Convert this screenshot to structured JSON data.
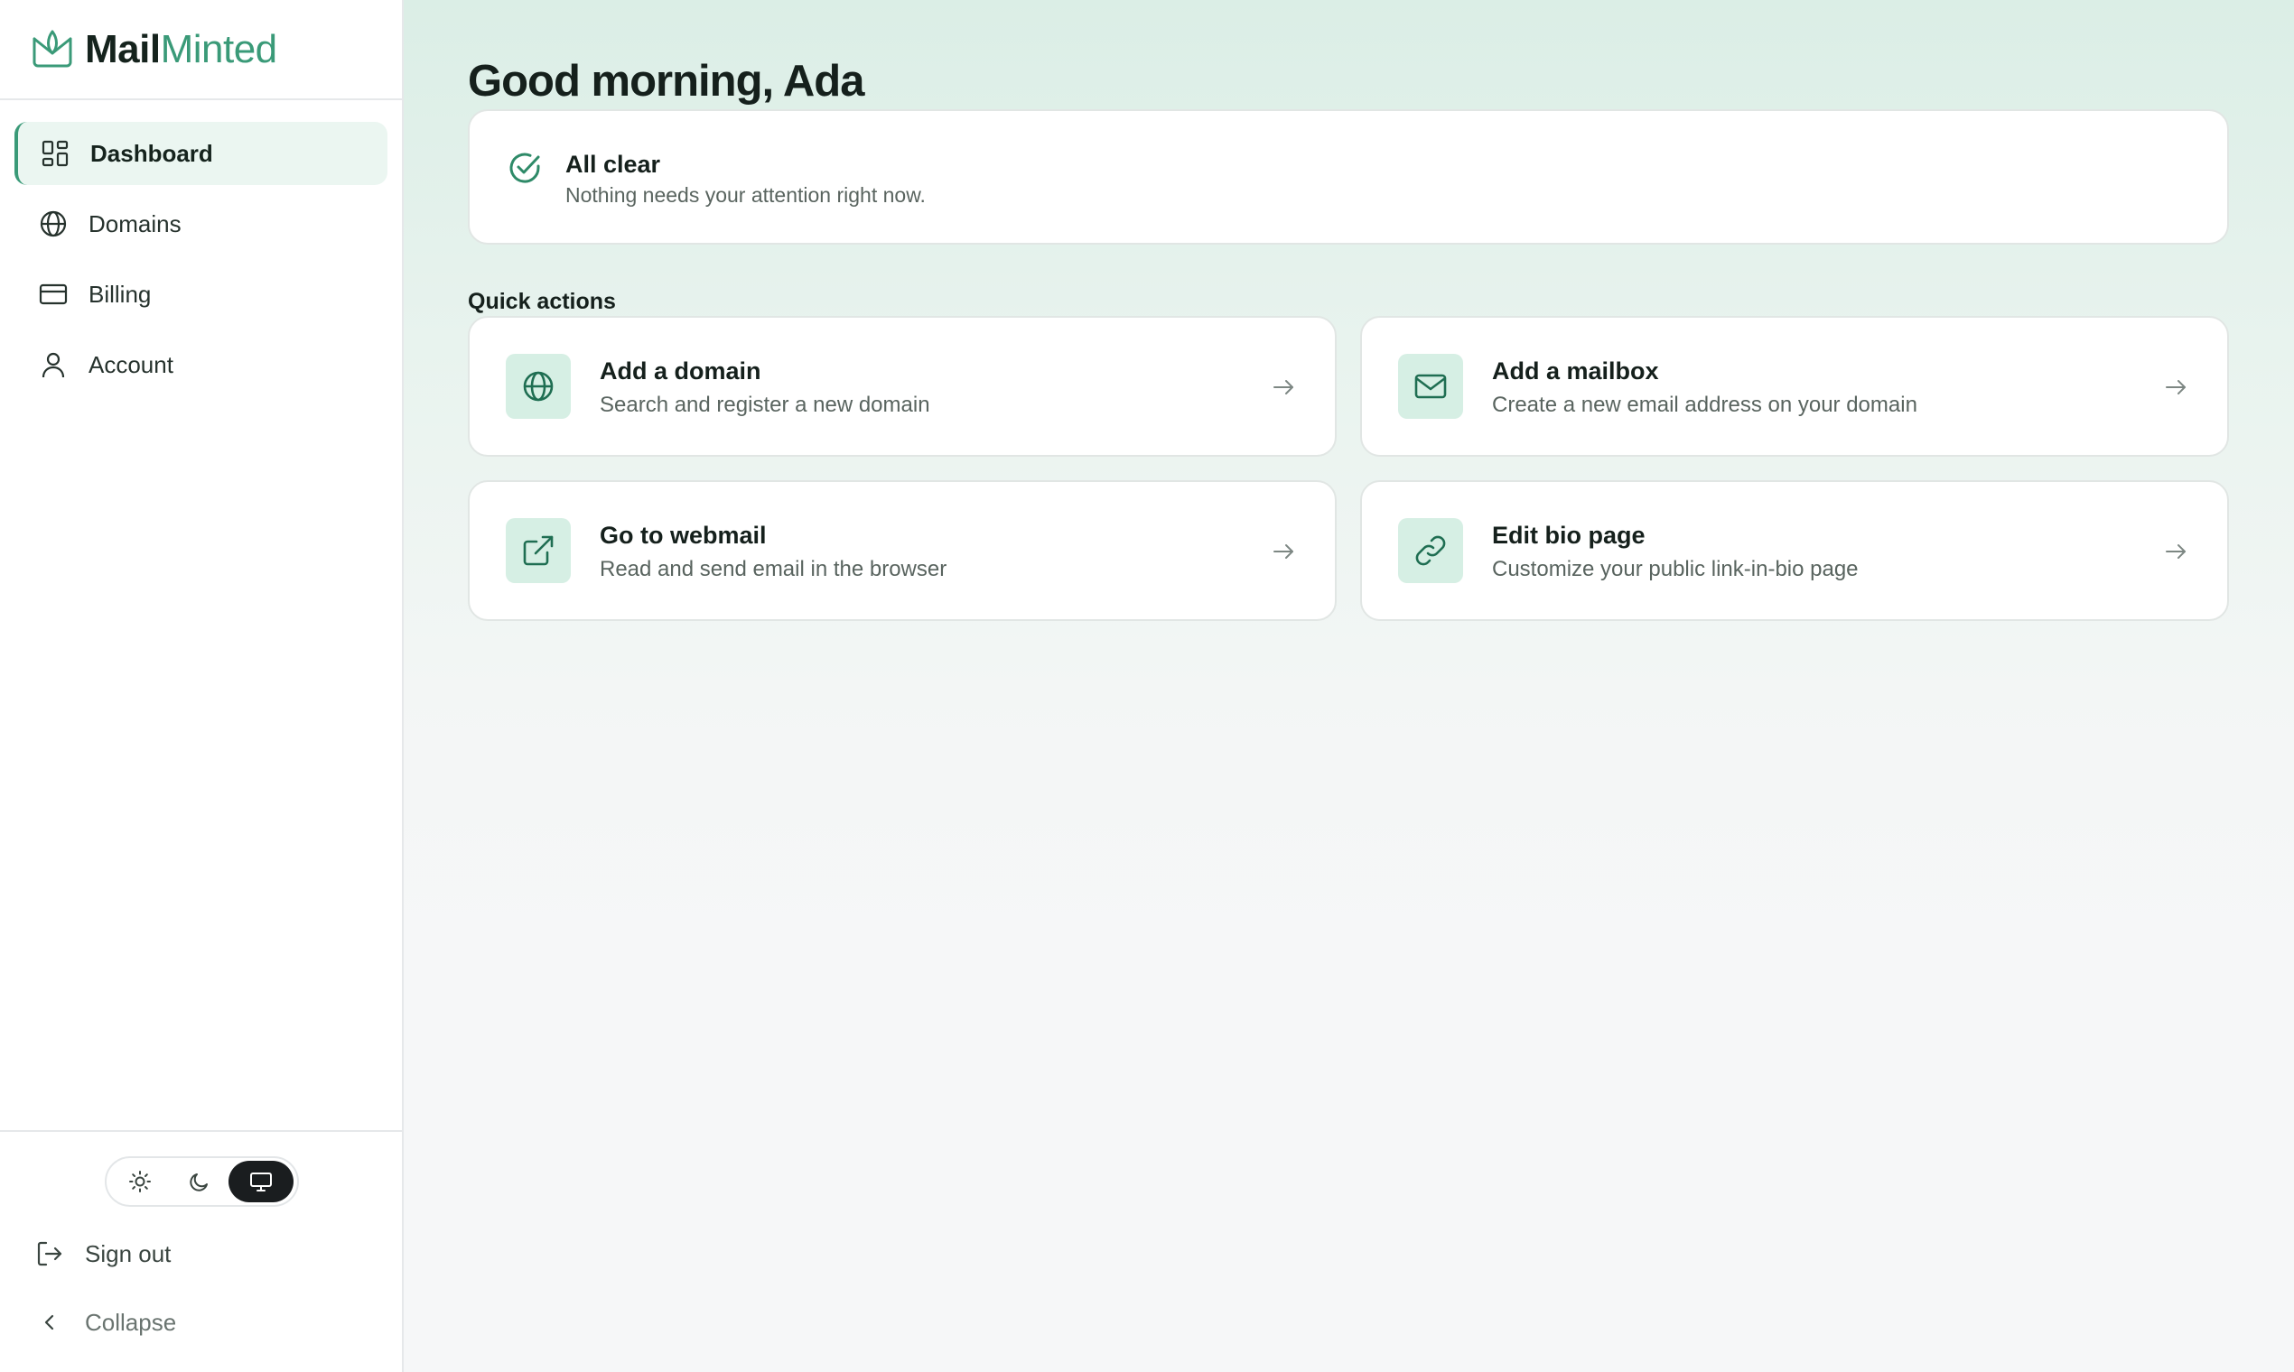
{
  "brand": {
    "name_bold": "Mail",
    "name_light": "Minted",
    "logo_icon": "leaf-mail-icon"
  },
  "sidebar": {
    "items": [
      {
        "label": "Dashboard",
        "icon": "dashboard-grid-icon",
        "active": true
      },
      {
        "label": "Domains",
        "icon": "globe-icon",
        "active": false
      },
      {
        "label": "Billing",
        "icon": "credit-card-icon",
        "active": false
      },
      {
        "label": "Account",
        "icon": "user-icon",
        "active": false
      }
    ],
    "theme_switch": {
      "options": [
        "light",
        "dark",
        "system"
      ],
      "selected": "system"
    },
    "sign_out": "Sign out",
    "collapse": "Collapse"
  },
  "main": {
    "greeting": "Good morning, Ada",
    "alert": {
      "title": "All clear",
      "subtitle": "Nothing needs your attention right now.",
      "icon": "check-circle-icon"
    },
    "quick_actions_title": "Quick actions",
    "quick_actions": [
      {
        "title": "Add a domain",
        "subtitle": "Search and register a new domain",
        "icon": "globe-icon"
      },
      {
        "title": "Add a mailbox",
        "subtitle": "Create a new email address on your domain",
        "icon": "mail-icon"
      },
      {
        "title": "Go to webmail",
        "subtitle": "Read and send email in the browser",
        "icon": "external-link-icon"
      },
      {
        "title": "Edit bio page",
        "subtitle": "Customize your public link-in-bio page",
        "icon": "link-icon"
      }
    ]
  },
  "colors": {
    "accent": "#3a9a78",
    "accent_dark": "#1f6e52",
    "accent_bg": "#ebf6f1",
    "text": "#15201c",
    "muted": "#59645f"
  }
}
